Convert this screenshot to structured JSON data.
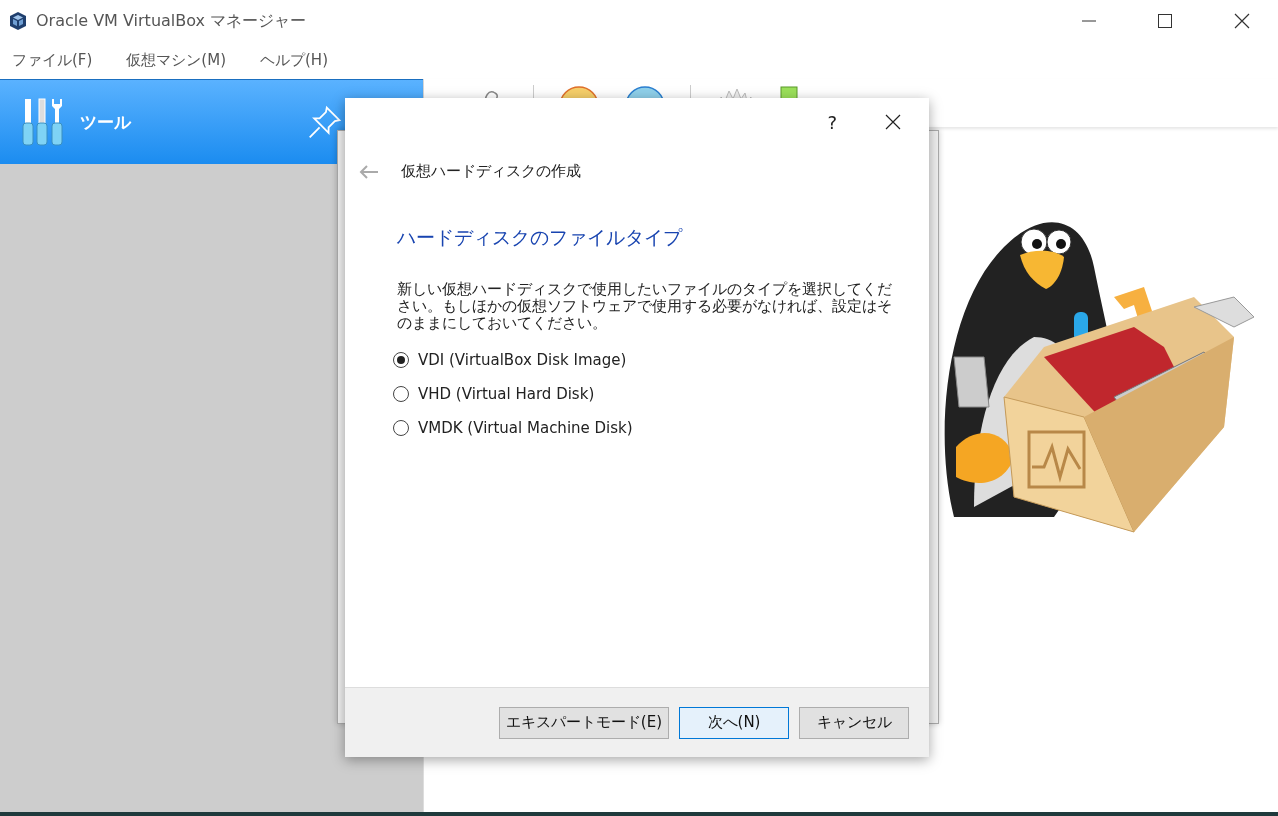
{
  "window": {
    "title": "Oracle VM VirtualBox マネージャー"
  },
  "menu": [
    "ファイル(F)",
    "仮想マシン(M)",
    "ヘルプ(H)"
  ],
  "sidebar": {
    "tools_label": "ツール",
    "selected": true
  },
  "dialog": {
    "help": "?",
    "back_title": "仮想ハードディスクの作成",
    "heading": "ハードディスクのファイルタイプ",
    "description": "新しい仮想ハードディスクで使用したいファイルのタイプを選択してください。もしほかの仮想ソフトウェアで使用する必要がなければ、設定はそのままにしておいてください。",
    "options": [
      {
        "label": "VDI (VirtualBox Disk Image)",
        "selected": true
      },
      {
        "label": "VHD (Virtual Hard Disk)",
        "selected": false
      },
      {
        "label": "VMDK (Virtual Machine Disk)",
        "selected": false
      }
    ],
    "buttons": [
      {
        "label": "エキスパートモード(E)",
        "default": false
      },
      {
        "label": "次へ(N)",
        "default": true
      },
      {
        "label": "キャンセル",
        "default": false
      }
    ]
  }
}
